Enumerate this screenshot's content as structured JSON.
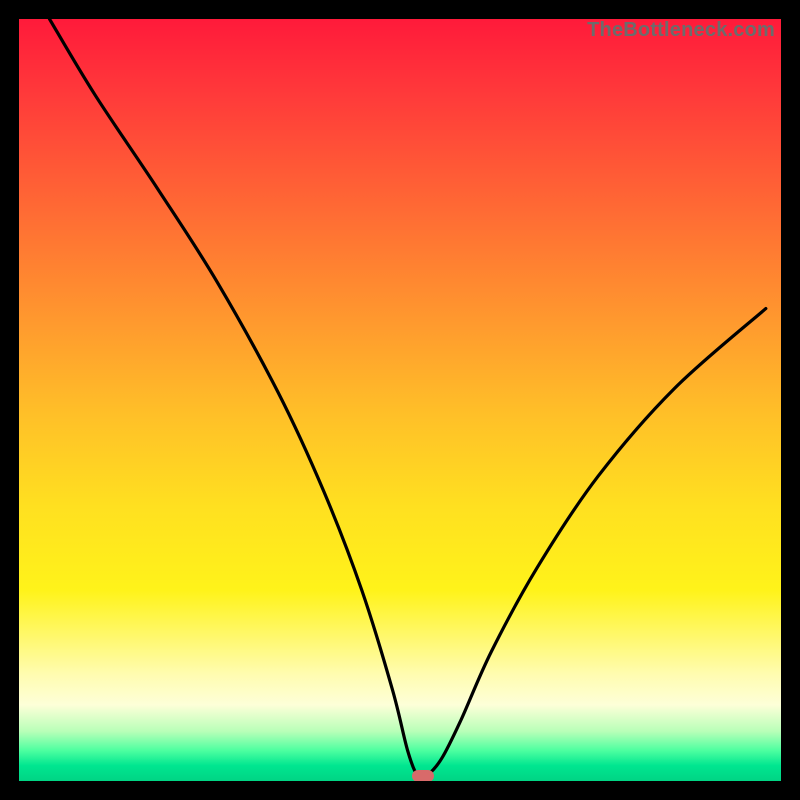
{
  "watermark": "TheBottleneck.com",
  "colors": {
    "frame": "#000000",
    "curve": "#000000",
    "marker": "#d86a6a"
  },
  "chart_data": {
    "type": "line",
    "title": "",
    "xlabel": "",
    "ylabel": "",
    "xlim": [
      0,
      100
    ],
    "ylim": [
      0,
      100
    ],
    "grid": false,
    "note": "V-shaped bottleneck curve; y approximates percent bottleneck, x is relative hardware balance. Minimum near x≈53.",
    "series": [
      {
        "name": "bottleneck-curve",
        "x": [
          4,
          10,
          18,
          26,
          34,
          40,
          45,
          49,
          51,
          52.3,
          53.5,
          55.5,
          58,
          62,
          68,
          76,
          86,
          98
        ],
        "y": [
          100,
          90,
          78,
          65.5,
          51,
          38,
          25,
          12,
          4,
          0.7,
          0.7,
          3,
          8,
          17,
          28,
          40,
          51.5,
          62
        ]
      }
    ],
    "marker": {
      "x": 53,
      "y": 0.7
    }
  }
}
